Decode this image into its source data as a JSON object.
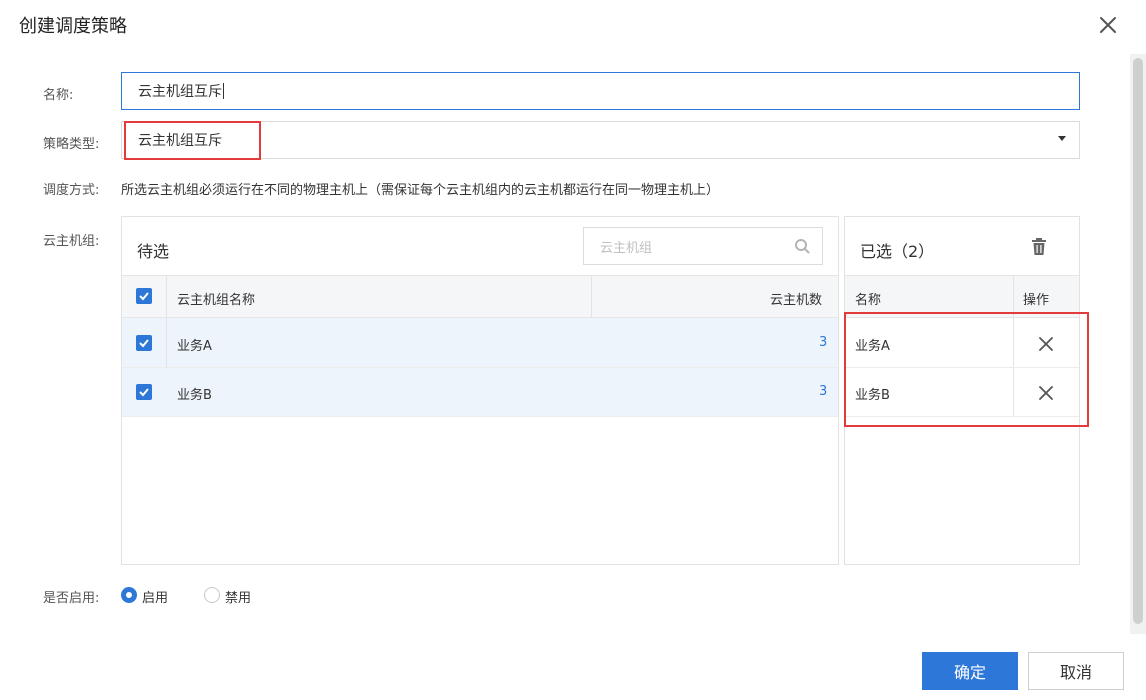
{
  "dialog": {
    "title": "创建调度策略"
  },
  "form": {
    "name_label": "名称:",
    "name_value": "云主机组互斥",
    "type_label": "策略类型:",
    "type_value": "云主机组互斥",
    "mode_label": "调度方式:",
    "mode_desc": "所选云主机组必须运行在不同的物理主机上（需保证每个云主机组内的云主机都运行在同一物理主机上）",
    "group_label": "云主机组:",
    "enable_label": "是否启用:",
    "enable_options": [
      "启用",
      "禁用"
    ],
    "enable_selected": "启用"
  },
  "available": {
    "title": "待选",
    "search_placeholder": "云主机组",
    "columns": [
      "云主机组名称",
      "云主机数"
    ],
    "rows": [
      {
        "name": "业务A",
        "count": "3",
        "checked": true
      },
      {
        "name": "业务B",
        "count": "3",
        "checked": true
      }
    ]
  },
  "selected": {
    "title": "已选（2）",
    "columns": [
      "名称",
      "操作"
    ],
    "rows": [
      {
        "name": "业务A"
      },
      {
        "name": "业务B"
      }
    ]
  },
  "footer": {
    "confirm_label": "确定",
    "cancel_label": "取消"
  },
  "colors": {
    "primary": "#2d77d8",
    "highlight": "#e33b3b",
    "selected_row": "#eef4fc"
  }
}
